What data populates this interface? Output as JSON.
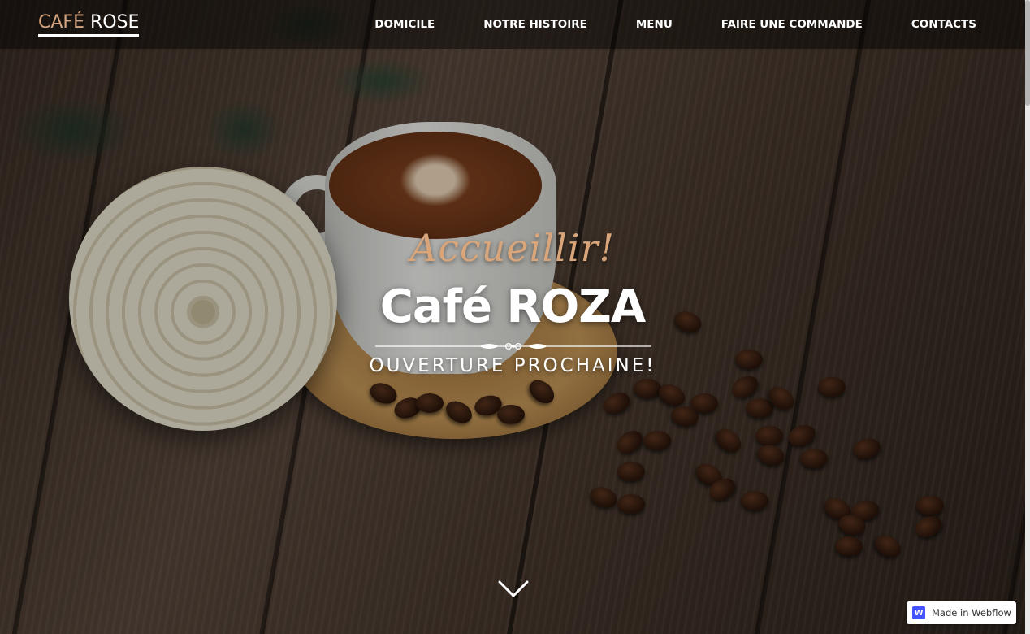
{
  "navbar": {
    "brand_primary": "CAFÉ",
    "brand_secondary": "ROSE",
    "links": [
      "DOMICILE",
      "NOTRE HISTOIRE",
      "MENU",
      "FAIRE UNE COMMANDE",
      "CONTACTS"
    ]
  },
  "hero": {
    "welcome": "Accueillir!",
    "title": "Café ROZA",
    "subtitle": "OUVERTURE PROCHAINE!",
    "scroll_icon": "chevron-down-icon"
  },
  "badge": {
    "icon_letter": "W",
    "text": "Made in Webflow"
  },
  "colors": {
    "accent": "#d9a57a",
    "brand_accent": "#d4a37f",
    "text": "#ffffff",
    "badge_icon": "#4353ff"
  }
}
